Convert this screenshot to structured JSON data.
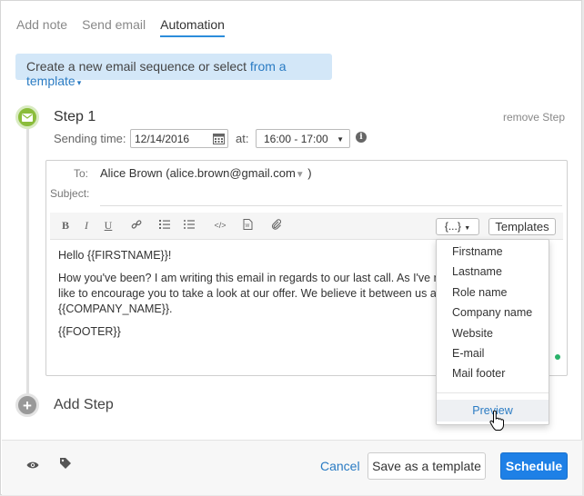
{
  "tabs": [
    {
      "label": "Add note",
      "active": false
    },
    {
      "label": "Send email",
      "active": false
    },
    {
      "label": "Automation",
      "active": true
    }
  ],
  "banner": {
    "text": "Create a new email sequence or select ",
    "link": "from a template",
    "caret": "▾"
  },
  "step": {
    "title": "Step 1",
    "remove_label": "remove Step",
    "sending_time_label": "Sending time:",
    "date_value": "12/14/2016",
    "at_label": "at:",
    "time_value": "16:00 - 17:00",
    "info_glyph": "i"
  },
  "email": {
    "to_label": "To:",
    "to_value": "Alice Brown  (alice.brown@gmail.com",
    "to_suffix": " )",
    "subject_label": "Subject:",
    "subject_value": "",
    "toolbar": {
      "bold": "B",
      "italic": "I",
      "underline": "U",
      "variables_label": "{...}",
      "templates_label": "Templates"
    },
    "body": [
      "Hello {{FIRSTNAME}}!",
      "How you've been? I am writing this email in regards to our last call. As I've mentioned, I'd like to encourage you to take a look at our offer. We believe it between us and {{COMPANY_NAME}}.",
      "{{FOOTER}}"
    ]
  },
  "variables_menu": {
    "items": [
      "Firstname",
      "Lastname",
      "Role name",
      "Company name",
      "Website",
      "E-mail",
      "Mail footer"
    ],
    "preview_label": "Preview"
  },
  "add_step_label": "Add Step",
  "footer": {
    "cancel_label": "Cancel",
    "save_template_label": "Save as a template",
    "schedule_label": "Schedule"
  },
  "colors": {
    "accent": "#1e80e6",
    "link": "#2a7bc3",
    "step_green": "#8bbd3b",
    "banner_bg": "#d3e7f8"
  }
}
